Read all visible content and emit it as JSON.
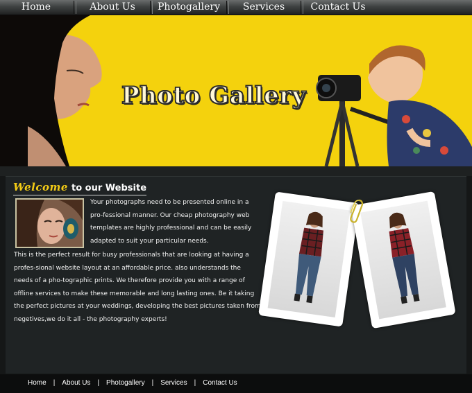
{
  "nav": {
    "items": [
      {
        "label": "Home"
      },
      {
        "label": "About Us"
      },
      {
        "label": "Photogallery"
      },
      {
        "label": "Services"
      },
      {
        "label": "Contact Us"
      }
    ]
  },
  "banner": {
    "title": "Photo Gallery",
    "background_color": "#f4d20d"
  },
  "welcome": {
    "heading_highlight": "Welcome",
    "heading_rest": "to our Website",
    "paragraph1": "Your photographs need to be presented online in a pro-fessional manner. Our cheap photography web templates are highly professional and can be easily adapted to suit your particular needs.",
    "paragraph2": "This is the perfect result for busy professionals that are looking at having a profes-sional website layout at an affordable price. also understands the needs of a pho-tographic prints. We therefore provide you with a range of offline services to make these memorable and long lasting ones. Be it taking the perfect pictures at your weddings, developing the best pictures taken from negetives,we do it all - the photography experts!"
  },
  "footer": {
    "links": [
      {
        "label": "Home"
      },
      {
        "label": "About Us"
      },
      {
        "label": "Photogallery"
      },
      {
        "label": "Services"
      },
      {
        "label": "Contact Us"
      }
    ],
    "separator": "|"
  },
  "colors": {
    "accent_yellow": "#f4cc16",
    "page_background": "#151717",
    "content_background": "#1f2324"
  },
  "icons": {
    "polaroid_clip": "paperclip-icon"
  }
}
